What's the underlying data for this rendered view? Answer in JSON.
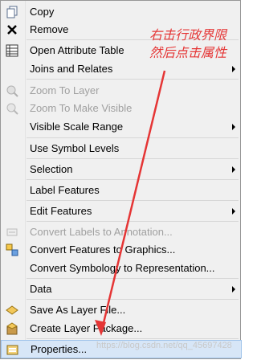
{
  "menu": {
    "items": [
      {
        "label": "Copy",
        "icon": "copy-icon"
      },
      {
        "label": "Remove",
        "icon": "remove-icon"
      },
      {
        "label": "Open Attribute Table",
        "icon": "table-icon"
      },
      {
        "label": "Joins and Relates",
        "icon": ""
      },
      {
        "label": "Zoom To Layer",
        "icon": "zoom-layer-icon"
      },
      {
        "label": "Zoom To Make Visible",
        "icon": "zoom-visible-icon"
      },
      {
        "label": "Visible Scale Range",
        "icon": ""
      },
      {
        "label": "Use Symbol Levels",
        "icon": ""
      },
      {
        "label": "Selection",
        "icon": ""
      },
      {
        "label": "Label Features",
        "icon": ""
      },
      {
        "label": "Edit Features",
        "icon": ""
      },
      {
        "label": "Convert Labels to Annotation...",
        "icon": "convert-labels-icon"
      },
      {
        "label": "Convert Features to Graphics...",
        "icon": "convert-features-icon"
      },
      {
        "label": "Convert Symbology to Representation...",
        "icon": ""
      },
      {
        "label": "Data",
        "icon": ""
      },
      {
        "label": "Save As Layer File...",
        "icon": "layer-file-icon"
      },
      {
        "label": "Create Layer Package...",
        "icon": "layer-package-icon"
      },
      {
        "label": "Properties...",
        "icon": "properties-icon"
      }
    ]
  },
  "annotation": {
    "line1": "右击行政界限",
    "line2": "然后点击属性"
  },
  "watermark": "https://blog.csdn.net/qq_45697428",
  "colors": {
    "annotation": "#e53535",
    "highlight": "#d7e6f7",
    "disabled": "#a0a0a0"
  }
}
